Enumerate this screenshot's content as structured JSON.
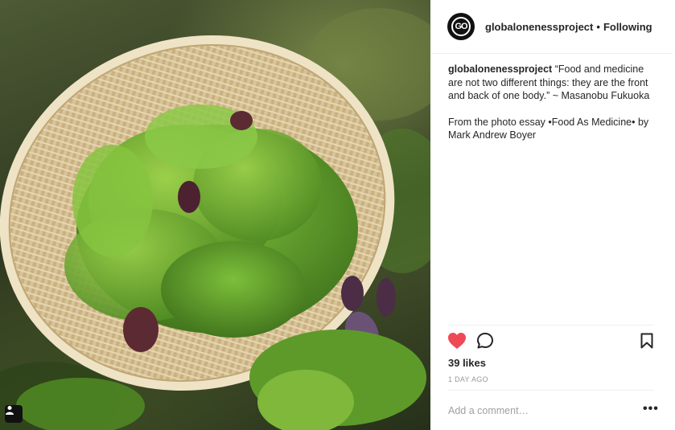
{
  "post": {
    "image_alt": "Basket of salad greens",
    "user_tag_icon": "person-icon"
  },
  "header": {
    "avatar_text": "GO",
    "username": "globalonenessproject",
    "separator": "•",
    "follow_status": "Following"
  },
  "caption": {
    "username": "globalonenessproject",
    "quote": "“Food and medicine are not two different things: they are the front and back of one body.” ~ Masanobu Fukuoka",
    "credit": "From the photo essay •Food As Medicine• by Mark Andrew Boyer"
  },
  "actions": {
    "like_icon": "heart-icon",
    "like_color": "#ed4956",
    "comment_icon": "comment-icon",
    "save_icon": "bookmark-icon"
  },
  "stats": {
    "likes": "39 likes",
    "time": "1 DAY AGO"
  },
  "comment": {
    "placeholder": "Add a comment…",
    "more_label": "•••"
  }
}
